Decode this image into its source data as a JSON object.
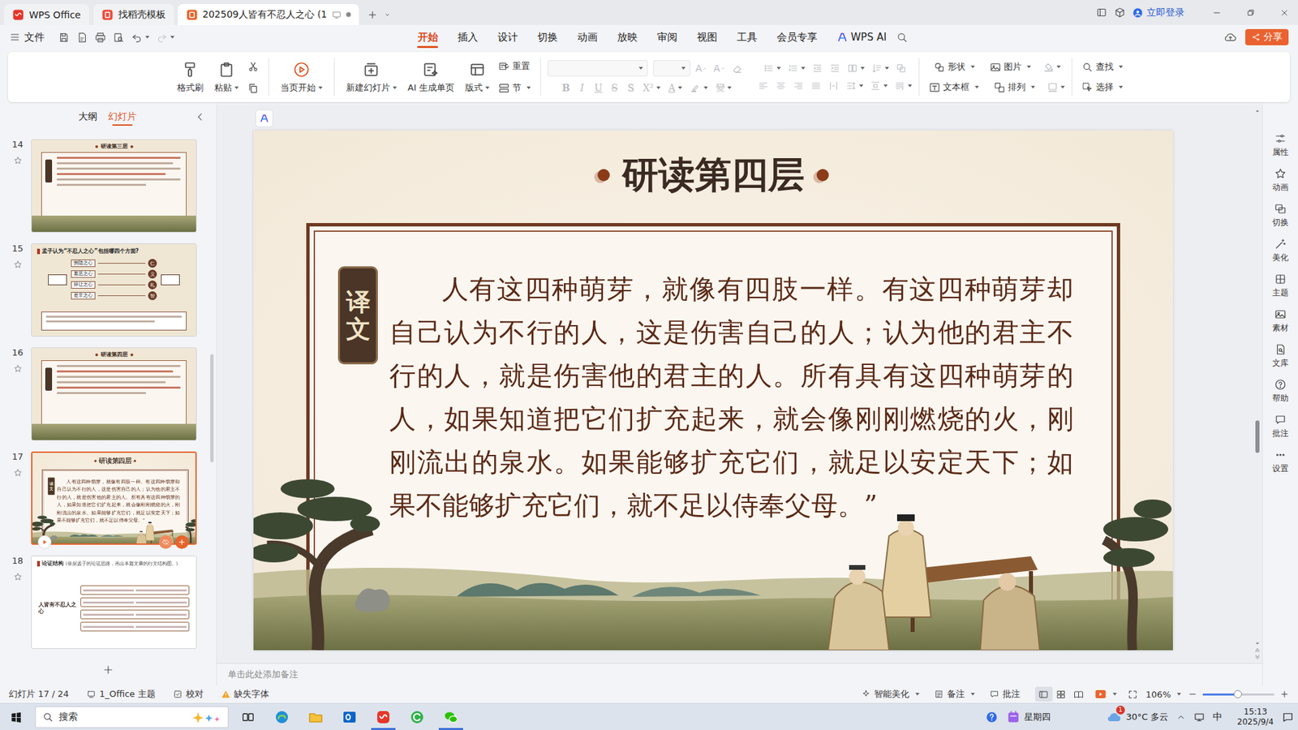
{
  "window": {
    "tabs": [
      {
        "label": "WPS Office",
        "selected": false
      },
      {
        "label": "找稻壳模板",
        "selected": false
      },
      {
        "label": "202509人皆有不忍人之心 (1",
        "selected": true
      }
    ],
    "login": "立即登录"
  },
  "menu": {
    "file": "文件",
    "quick_tools": [
      {
        "disabled": false
      },
      {
        "disabled": false
      },
      {
        "disabled": false
      },
      {
        "disabled": false
      },
      {
        "disabled": false
      },
      {
        "disabled": true
      }
    ],
    "tabs": [
      {
        "label": "开始",
        "selected": true
      },
      {
        "label": "插入",
        "selected": false
      },
      {
        "label": "设计",
        "selected": false
      },
      {
        "label": "切换",
        "selected": false
      },
      {
        "label": "动画",
        "selected": false
      },
      {
        "label": "放映",
        "selected": false
      },
      {
        "label": "审阅",
        "selected": false
      },
      {
        "label": "视图",
        "selected": false
      },
      {
        "label": "工具",
        "selected": false
      },
      {
        "label": "会员专享",
        "selected": false
      },
      {
        "label": "WPS AI",
        "selected": false
      }
    ],
    "share": "分享"
  },
  "ribbon": {
    "buttons": [
      {
        "label": "格式刷",
        "dropdown": false
      },
      {
        "label": "粘贴",
        "dropdown": true
      },
      {
        "label": "当页开始",
        "dropdown": true
      },
      {
        "label": "新建幻灯片",
        "dropdown": true
      },
      {
        "label": "AI 生成单页",
        "dropdown": false
      },
      {
        "label": "版式",
        "dropdown": true
      }
    ],
    "reset": "重置",
    "section": "节",
    "font_group": {
      "disabled": true,
      "row1": [
        "A",
        "A"
      ],
      "row2": [
        {
          "label": "B",
          "dropdown": false
        },
        {
          "label": "I",
          "dropdown": false
        },
        {
          "label": "U",
          "dropdown": false
        },
        {
          "label": "S",
          "dropdown": false
        },
        {
          "label": "S",
          "dropdown": false
        },
        {
          "label": "X²",
          "dropdown": true
        },
        {
          "label": "A",
          "dropdown": true
        },
        {
          "label": "變",
          "dropdown": true
        }
      ]
    },
    "paragraph_group": {
      "disabled": true
    },
    "shape": "形状",
    "picture": "图片",
    "textbox": "文本框",
    "arrange": "排列",
    "find": "查找",
    "select": "选择"
  },
  "panel": {
    "tabs": [
      {
        "label": "大纲",
        "selected": false
      },
      {
        "label": "幻灯片",
        "selected": true
      }
    ],
    "scroll": 0.54,
    "slides": [
      {
        "number": "14",
        "title": "研读第三层",
        "selected": false,
        "kind": "reading"
      },
      {
        "number": "15",
        "title": "孟子认为“不忍人之心”包括哪四个方面?",
        "selected": false,
        "kind": "diagram",
        "items": [
          {
            "heart": "恻隐之心",
            "virtue": "仁"
          },
          {
            "heart": "羞恶之心",
            "virtue": "义"
          },
          {
            "heart": "辞让之心",
            "virtue": "礼"
          },
          {
            "heart": "是非之心",
            "virtue": "智"
          }
        ]
      },
      {
        "number": "16",
        "title": "研读第四层",
        "selected": false,
        "kind": "reading"
      },
      {
        "number": "17",
        "selected": true,
        "kind": "translation"
      },
      {
        "number": "18",
        "title": "论证结构",
        "subtitle": "(依据孟子的论证思路，画出本篇文章的行文结构图。)",
        "selected": false,
        "kind": "structure",
        "labels": [
          "人皆有不忍人之心"
        ]
      }
    ]
  },
  "canvas": {
    "scroll": 0.62
  },
  "slide": {
    "title": "研读第四层",
    "label": "译文",
    "body": "人有这四种萌芽，就像有四肢一样。有这四种萌芽却自己认为不行的人，这是伤害自己的人；认为他的君主不行的人，就是伤害他的君主的人。所有具有这四种萌芽的人，如果知道把它们扩充起来，就会像刚刚燃烧的火，刚刚流出的泉水。如果能够扩充它们，就足以安定天下；如果不能够扩充它们，就不足以侍奉父母。”"
  },
  "notes": {
    "placeholder": "单击此处添加备注"
  },
  "side_tools": [
    {
      "label": "属性"
    },
    {
      "label": "动画"
    },
    {
      "label": "切换"
    },
    {
      "label": "美化"
    },
    {
      "label": "主题"
    },
    {
      "label": "素材"
    },
    {
      "label": "文库"
    },
    {
      "label": "帮助"
    },
    {
      "label": "批注"
    },
    {
      "label": "设置"
    }
  ],
  "status_bar": {
    "slide": "幻灯片 17 / 24",
    "theme": "1_Office 主题",
    "proofing": "校对",
    "missing_font": "缺失字体",
    "smart": "智能美化",
    "notes": "备注",
    "comments": "批注",
    "views": [
      {
        "selected": true
      },
      {
        "selected": false
      },
      {
        "selected": false
      }
    ],
    "zoom": "106%",
    "zoom_level": 0.49
  },
  "taskbar": {
    "search": "搜索",
    "apps": [
      {
        "active": false
      },
      {
        "active": false
      },
      {
        "active": false
      },
      {
        "active": true
      },
      {
        "active": false
      },
      {
        "active": true
      }
    ],
    "day": "星期四",
    "badge": "1",
    "weather": "30°C 多云",
    "ime": "中",
    "time": "15:13",
    "date": "2025/9/4"
  }
}
